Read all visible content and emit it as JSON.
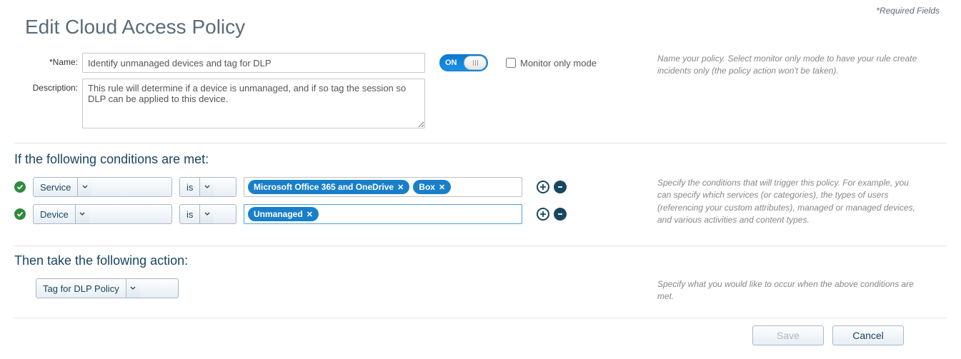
{
  "header": {
    "required_fields_note": "*Required Fields",
    "title": "Edit Cloud Access Policy"
  },
  "form": {
    "name_label": "Name:",
    "name_value": "Identify unmanaged devices and tag for DLP",
    "description_label": "Description:",
    "description_value": "This rule will determine if a device is unmanaged, and if so tag the session so DLP can be applied to this device.",
    "toggle_state": "ON",
    "monitor_only_label": "Monitor only mode",
    "monitor_only_checked": false,
    "help": "Name your policy. Select monitor only mode to have your rule create incidents only (the policy action won't be taken)."
  },
  "conditions": {
    "heading": "If the following conditions are met:",
    "help": "Specify the conditions that will trigger this policy. For example, you can specify which services (or categories), the types of users (referencing your custom attributes), managed or managed devices, and various activities and content types.",
    "rows": [
      {
        "valid": true,
        "subject": "Service",
        "operator": "is",
        "tags": [
          "Microsoft Office 365 and OneDrive",
          "Box"
        ]
      },
      {
        "valid": true,
        "subject": "Device",
        "operator": "is",
        "tags": [
          "Unmanaged"
        ]
      }
    ]
  },
  "action": {
    "heading": "Then take the following action:",
    "selected": "Tag for DLP Policy",
    "help": "Specify what you would like to occur when the above conditions are met."
  },
  "footer": {
    "save_label": "Save",
    "cancel_label": "Cancel"
  }
}
